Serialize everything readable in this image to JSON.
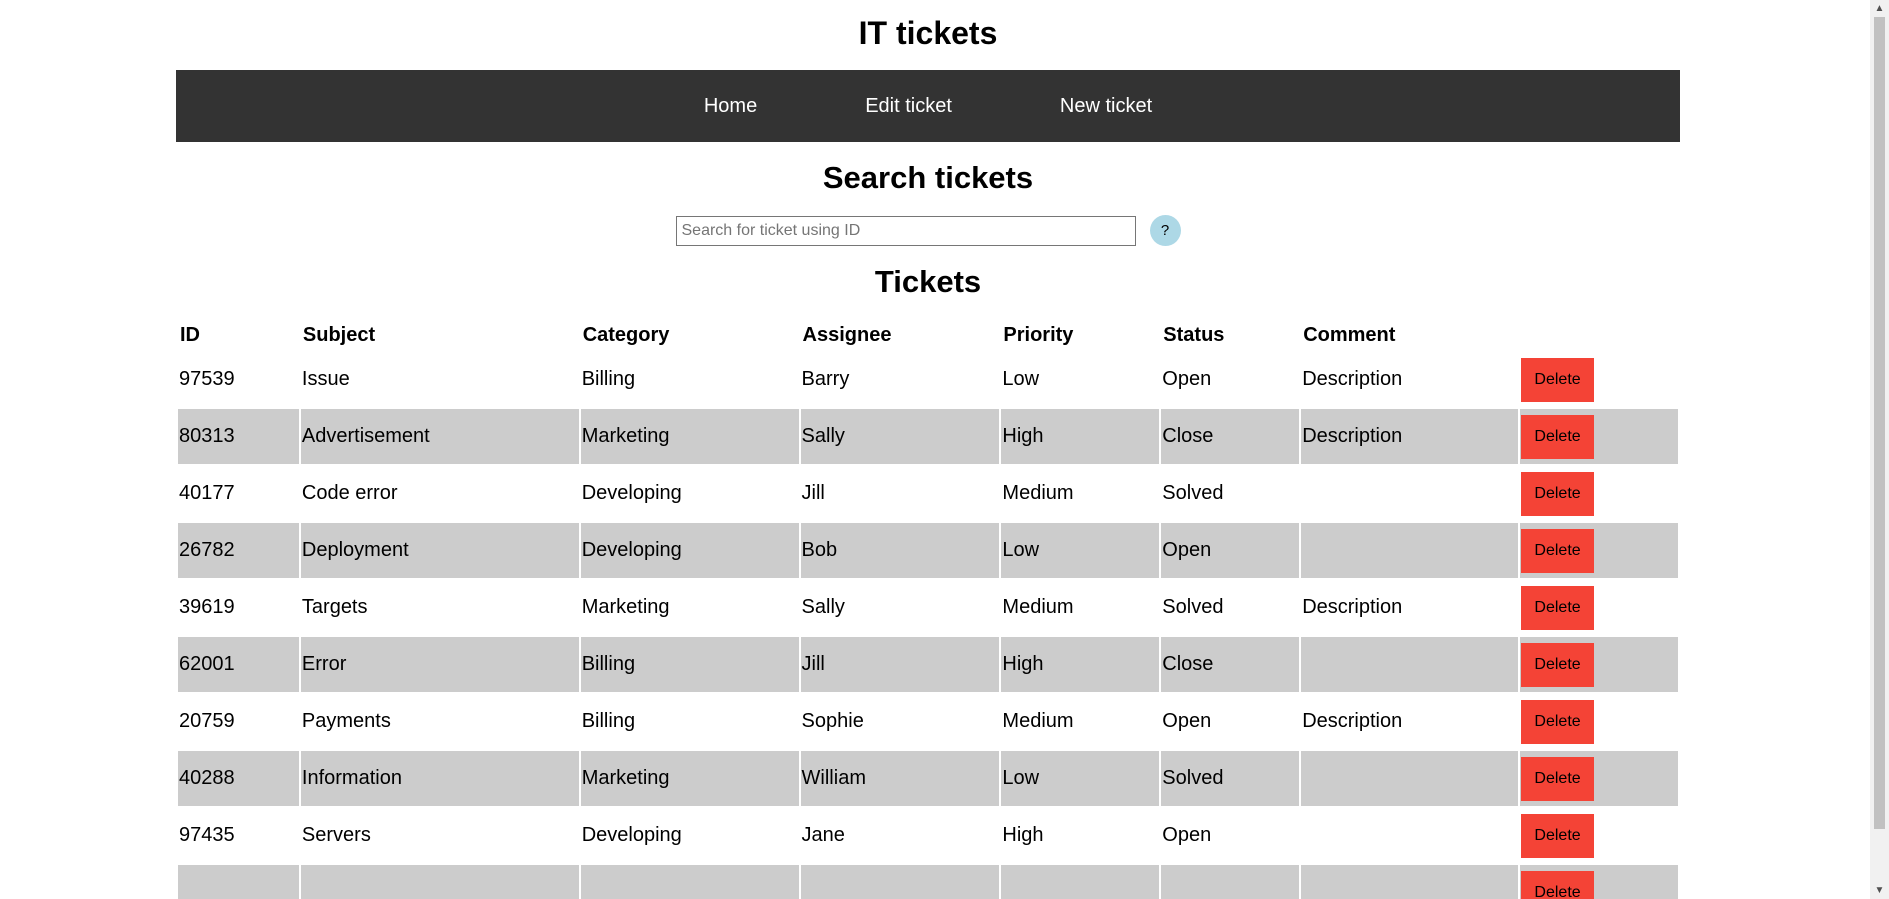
{
  "header": {
    "title": "IT tickets"
  },
  "nav": {
    "items": [
      {
        "label": "Home"
      },
      {
        "label": "Edit ticket"
      },
      {
        "label": "New ticket"
      }
    ]
  },
  "search": {
    "heading": "Search tickets",
    "placeholder": "Search for ticket using ID",
    "help_label": "?"
  },
  "tickets": {
    "heading": "Tickets",
    "columns": [
      "ID",
      "Subject",
      "Category",
      "Assignee",
      "Priority",
      "Status",
      "Comment"
    ],
    "delete_label": "Delete",
    "rows": [
      [
        "97539",
        "Issue",
        "Billing",
        "Barry",
        "Low",
        "Open",
        "Description"
      ],
      [
        "80313",
        "Advertisement",
        "Marketing",
        "Sally",
        "High",
        "Close",
        "Description"
      ],
      [
        "40177",
        "Code error",
        "Developing",
        "Jill",
        "Medium",
        "Solved",
        ""
      ],
      [
        "26782",
        "Deployment",
        "Developing",
        "Bob",
        "Low",
        "Open",
        ""
      ],
      [
        "39619",
        "Targets",
        "Marketing",
        "Sally",
        "Medium",
        "Solved",
        "Description"
      ],
      [
        "62001",
        "Error",
        "Billing",
        "Jill",
        "High",
        "Close",
        ""
      ],
      [
        "20759",
        "Payments",
        "Billing",
        "Sophie",
        "Medium",
        "Open",
        "Description"
      ],
      [
        "40288",
        "Information",
        "Marketing",
        "William",
        "Low",
        "Solved",
        ""
      ],
      [
        "97435",
        "Servers",
        "Developing",
        "Jane",
        "High",
        "Open",
        ""
      ],
      [
        "",
        "",
        "",
        "",
        "",
        "",
        ""
      ]
    ]
  },
  "colors": {
    "navbar": "#333333",
    "row_shade": "#cccccc",
    "delete_button": "#f44336",
    "help_button": "#add8e6"
  },
  "icons": {
    "scroll_up": "scroll-up-arrow-icon",
    "scroll_down": "scroll-down-arrow-icon"
  }
}
